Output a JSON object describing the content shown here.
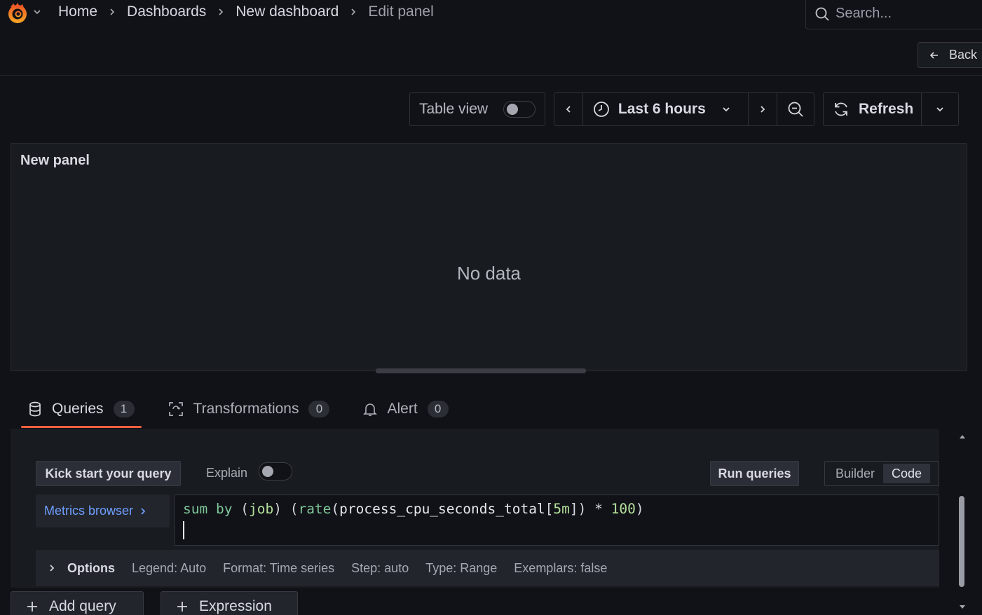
{
  "topbar": {
    "breadcrumbs": [
      "Home",
      "Dashboards",
      "New dashboard",
      "Edit panel"
    ],
    "search_placeholder": "Search..."
  },
  "subbar": {
    "back_label": "Back"
  },
  "toolbar": {
    "table_view_label": "Table view",
    "table_view_enabled": false,
    "time_range_label": "Last 6 hours",
    "refresh_label": "Refresh"
  },
  "panel": {
    "title": "New panel",
    "empty_text": "No data"
  },
  "tabs": [
    {
      "label": "Queries",
      "count": "1",
      "icon": "database-icon",
      "active": true
    },
    {
      "label": "Transformations",
      "count": "0",
      "icon": "transform-icon",
      "active": false
    },
    {
      "label": "Alert",
      "count": "0",
      "icon": "bell-icon",
      "active": false
    }
  ],
  "query": {
    "kick_start_label": "Kick start your query",
    "explain_label": "Explain",
    "explain_enabled": false,
    "run_label": "Run queries",
    "mode_options": [
      "Builder",
      "Code"
    ],
    "mode_selected": "Code",
    "metrics_browser_label": "Metrics browser",
    "expression": "sum by (job) (rate(process_cpu_seconds_total[5m]) * 100)",
    "options": {
      "label": "Options",
      "legend": "Legend: Auto",
      "format": "Format: Time series",
      "step": "Step: auto",
      "type": "Type: Range",
      "exemplars": "Exemplars: false"
    }
  },
  "actions": {
    "add_query_label": "Add query",
    "expression_label": "Expression"
  },
  "colors": {
    "accent": "#f55f3e",
    "link": "#6e9fff",
    "background": "#111217",
    "panel": "#181b1f"
  }
}
